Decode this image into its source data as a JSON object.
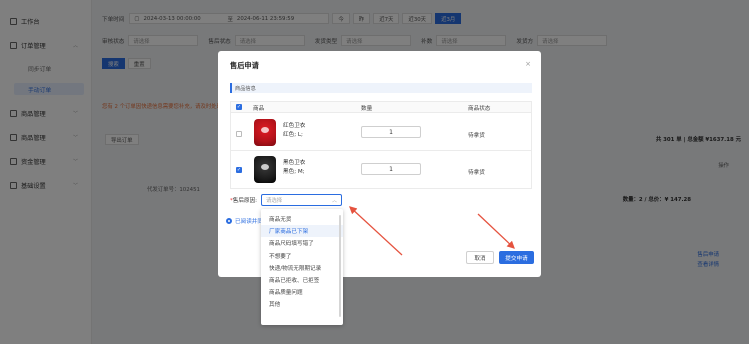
{
  "sidebar": {
    "items": [
      {
        "label": "工作台",
        "icon": "home-icon"
      },
      {
        "label": "订单管理",
        "icon": "order-icon",
        "expanded": true
      },
      {
        "label": "商品管理",
        "icon": "product-icon"
      },
      {
        "label": "商品管理",
        "icon": "box-icon"
      },
      {
        "label": "资金管理",
        "icon": "wallet-icon"
      },
      {
        "label": "基础设置",
        "icon": "gear-icon"
      }
    ],
    "sub_items": [
      {
        "label": "同步订单"
      },
      {
        "label": "手动订单",
        "active": true
      }
    ]
  },
  "filters": {
    "time_label": "下单时间",
    "date_from": "2024-03-13 00:00:00",
    "date_to": "2024-06-11 23:59:59",
    "quick": [
      "今",
      "昨",
      "近7天",
      "近30天",
      "近3月"
    ],
    "row2": [
      {
        "label": "审核状态",
        "placeholder": "请选择"
      },
      {
        "label": "售后状态",
        "placeholder": "请选择"
      },
      {
        "label": "发货类型",
        "placeholder": "请选择"
      },
      {
        "label": "补数",
        "placeholder": "请选择"
      },
      {
        "label": "发货方",
        "placeholder": "请选择"
      }
    ],
    "search_btn": "搜索",
    "reset_btn": "重置"
  },
  "background": {
    "notice": "您有 2 个订单因快递信息需要您补充，请及时处理",
    "export_btn": "导出订单",
    "totals": "共 301 单 | 总金额 ¥1637.18 元",
    "order_no": "代发订单号：102451",
    "stats": "数量：2 / 总价：¥ 147.28",
    "op_header": "操作",
    "after_sale_link": "售后申请",
    "detail_link": "查看详情"
  },
  "modal": {
    "title": "售后申请",
    "section": "商品信息",
    "table_headers": {
      "product": "商品",
      "qty": "数量",
      "status": "商品状态"
    },
    "rows": [
      {
        "name": "红色卫衣",
        "spec": "红色; L;",
        "qty": "1",
        "status": "待拿货",
        "checked": false,
        "color": "red"
      },
      {
        "name": "黑色卫衣",
        "spec": "黑色; M;",
        "qty": "1",
        "status": "待拿货",
        "checked": true,
        "color": "black"
      }
    ],
    "reason_label": "售后原因:",
    "reason_placeholder": "请选择",
    "radio_text": "已阅读并同意",
    "cancel": "取消",
    "submit": "提交申请"
  },
  "dropdown": {
    "options": [
      "商品无货",
      "厂家商品已下架",
      "商品尺码填写错了",
      "不想要了",
      "快递/物流无限期记录",
      "商品已拒收、已拒签",
      "商品质量问题",
      "其他"
    ],
    "hover_index": 1
  },
  "colors": {
    "accent": "#2b6de0",
    "arrow": "#e5533f"
  }
}
